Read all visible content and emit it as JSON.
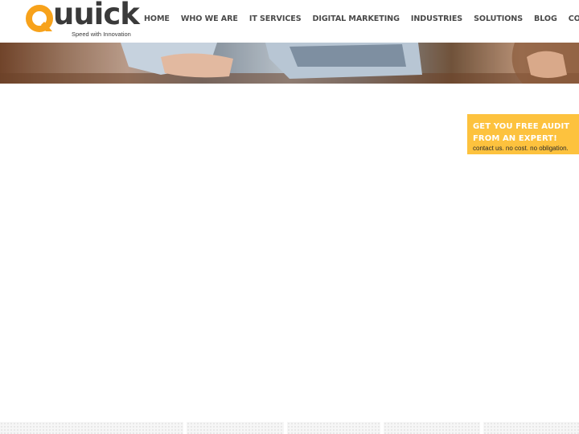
{
  "logo": {
    "wordmark": "uuick",
    "tagline": "Speed with Innovation",
    "mark_color": "#f7a21b"
  },
  "nav": {
    "items": [
      {
        "label": "HOME"
      },
      {
        "label": "WHO WE ARE"
      },
      {
        "label": "IT SERVICES"
      },
      {
        "label": "DIGITAL MARKETING"
      },
      {
        "label": "INDUSTRIES"
      },
      {
        "label": "SOLUTIONS"
      },
      {
        "label": "BLOG"
      },
      {
        "label": "CONTACT"
      }
    ]
  },
  "promo": {
    "title_line1": "GET YOU FREE AUDIT",
    "title_line2": "FROM AN EXPERT!",
    "subtitle": "contact us. no cost. no obligation.",
    "background": "#fdc23e"
  }
}
